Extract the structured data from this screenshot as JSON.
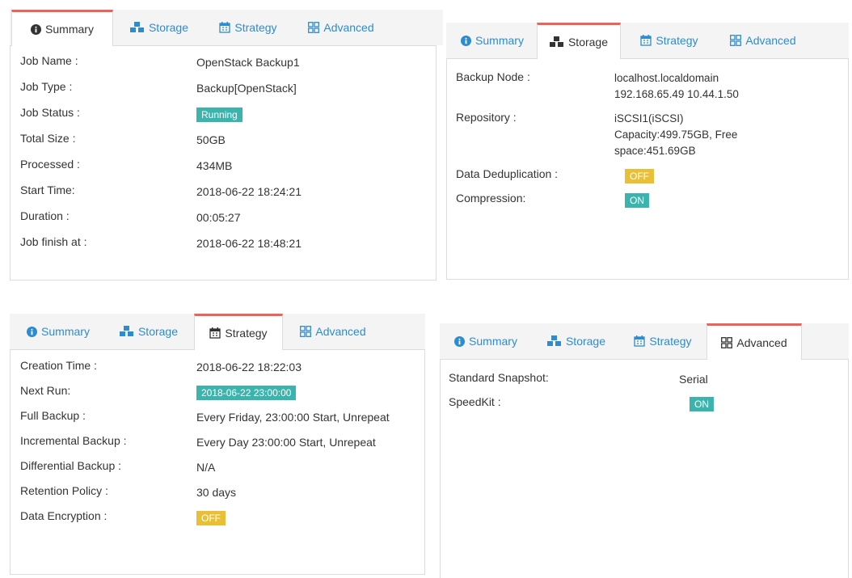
{
  "tabs": {
    "summary": "Summary",
    "storage": "Storage",
    "strategy": "Strategy",
    "advanced": "Advanced"
  },
  "summary_panel": {
    "rows": [
      {
        "label": "Job Name :",
        "value": "OpenStack Backup1"
      },
      {
        "label": "Job Type :",
        "value": "Backup[OpenStack]"
      },
      {
        "label": "Job Status :",
        "value": "Running"
      },
      {
        "label": "Total Size :",
        "value": "50GB"
      },
      {
        "label": "Processed :",
        "value": "434MB"
      },
      {
        "label": "Start Time:",
        "value": "2018-06-22 18:24:21"
      },
      {
        "label": "Duration :",
        "value": "00:05:27"
      },
      {
        "label": "Job finish at :",
        "value": "2018-06-22 18:48:21"
      }
    ]
  },
  "storage_panel": {
    "backup_node": {
      "label": "Backup Node :",
      "line1": "localhost.localdomain",
      "line2": "192.168.65.49 10.44.1.50"
    },
    "repository": {
      "label": "Repository :",
      "line1": "iSCSI1(iSCSI)",
      "line2": "Capacity:499.75GB, Free",
      "line3": "space:451.69GB"
    },
    "dedup": {
      "label": "Data Deduplication :",
      "value": "OFF"
    },
    "compression": {
      "label": "Compression:",
      "value": "ON"
    }
  },
  "strategy_panel": {
    "rows": [
      {
        "label": "Creation Time :",
        "value": "2018-06-22 18:22:03"
      },
      {
        "label": "Next Run:",
        "value": "2018-06-22 23:00:00"
      },
      {
        "label": "Full Backup :",
        "value": "Every Friday, 23:00:00 Start, Unrepeat"
      },
      {
        "label": "Incremental Backup :",
        "value": "Every Day 23:00:00 Start, Unrepeat"
      },
      {
        "label": "Differential Backup :",
        "value": "N/A"
      },
      {
        "label": "Retention Policy :",
        "value": "30 days"
      },
      {
        "label": "Data Encryption :",
        "value": "OFF"
      }
    ]
  },
  "advanced_panel": {
    "rows": [
      {
        "label": "Standard Snapshot:",
        "value": "Serial"
      },
      {
        "label": "SpeedKit :",
        "value": "ON"
      }
    ]
  },
  "colors": {
    "accent_tab_border": "#e8645d",
    "link_blue": "#2d8ccd",
    "badge_teal": "#3bb4ae",
    "badge_yellow": "#e9c035"
  },
  "icons": {
    "summary": "info-circle-icon",
    "storage": "cubes-icon",
    "strategy": "calendar-icon",
    "advanced": "grid-icon"
  }
}
